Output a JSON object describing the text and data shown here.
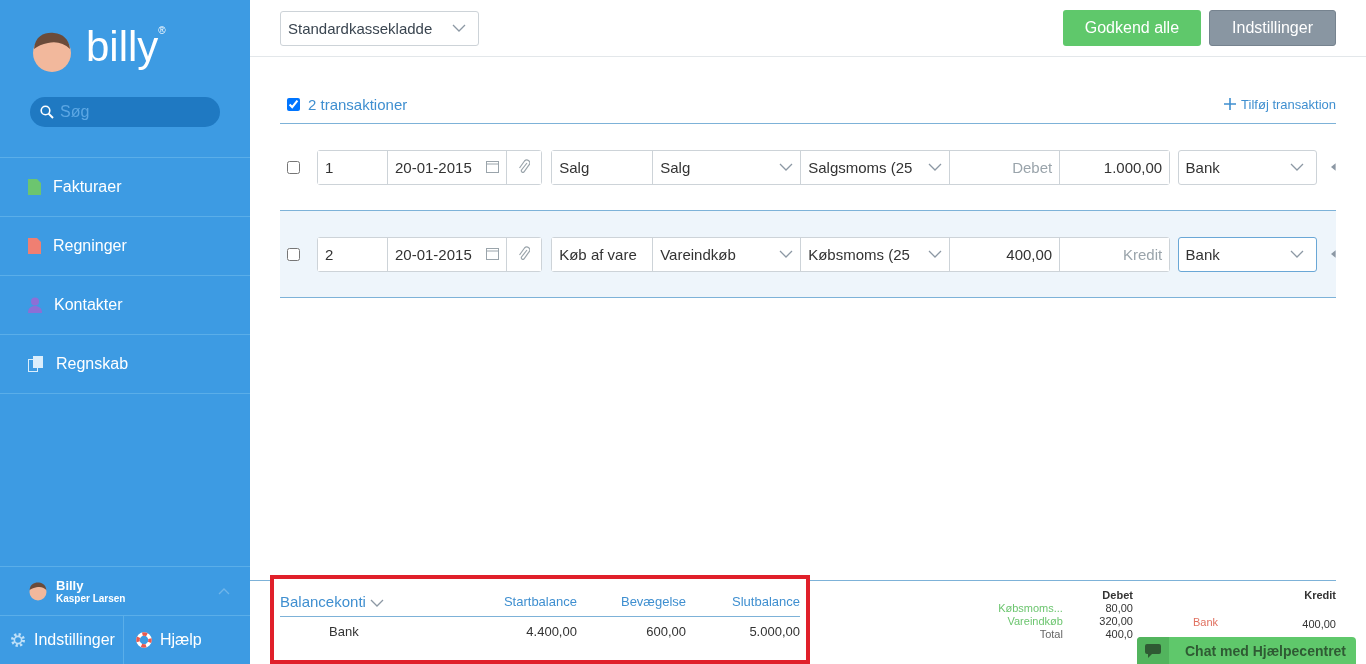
{
  "sidebar": {
    "logo": "billy",
    "logo_mark": "®",
    "search": {
      "placeholder": "Søg"
    },
    "nav": [
      {
        "label": "Fakturaer",
        "kind": "document",
        "color": "#6cc56f"
      },
      {
        "label": "Regninger",
        "kind": "document",
        "color": "#f07f72"
      },
      {
        "label": "Kontakter",
        "kind": "person",
        "color": "#8c6fd6"
      },
      {
        "label": "Regnskab",
        "kind": "copy",
        "color": "#dbeefc"
      }
    ],
    "user": {
      "name": "Billy",
      "org": "Kasper Larsen"
    },
    "footer": [
      {
        "label": "Indstillinger",
        "kind": "settings"
      },
      {
        "label": "Hjælp",
        "kind": "help"
      }
    ]
  },
  "toolbar": {
    "journal_select": "Standardkassekladde",
    "buttons": [
      {
        "label": "Godkend alle",
        "kind": "primary"
      },
      {
        "label": "Indstillinger",
        "kind": "secondary"
      }
    ]
  },
  "transactions": {
    "all_checked": true,
    "count_label": "2 transaktioner",
    "add_label": "Tilføj transaktion",
    "rows": [
      {
        "checked": false,
        "selected": false,
        "number": "1",
        "date": "20-01-2015",
        "description": "Salg",
        "account": "Salg",
        "vat": "Salgsmoms (25",
        "debit": {
          "placeholder": "Debet"
        },
        "credit": {
          "value": "1.000,00"
        },
        "contra": "Bank",
        "focused": false
      },
      {
        "checked": false,
        "selected": true,
        "number": "2",
        "date": "20-01-2015",
        "description": "Køb af vare",
        "account": "Vareindkøb",
        "vat": "Købsmoms (25",
        "debit": {
          "value": "400,00"
        },
        "credit": {
          "placeholder": "Kredit"
        },
        "contra": "Bank",
        "focused": true
      }
    ]
  },
  "balance": {
    "columns": [
      "Balancekonti",
      "Startbalance",
      "Bevægelse",
      "Slutbalance"
    ],
    "rows": [
      [
        "Bank",
        "4.400,00",
        "600,00",
        "5.000,00"
      ]
    ]
  },
  "summary": {
    "debit_heading": "Debet",
    "credit_heading": "Kredit",
    "debit_lines": [
      {
        "label": "Købsmoms...",
        "amount": "80,00",
        "kind": "account"
      },
      {
        "label": "Vareindkøb",
        "amount": "320,00",
        "kind": "account"
      },
      {
        "label": "Total",
        "amount": "400,0",
        "kind": "total"
      }
    ],
    "credit_lines": [
      {
        "label": "Bank",
        "amount": "400,00"
      }
    ]
  },
  "chat": {
    "label": "Chat med Hjælpecentret"
  }
}
